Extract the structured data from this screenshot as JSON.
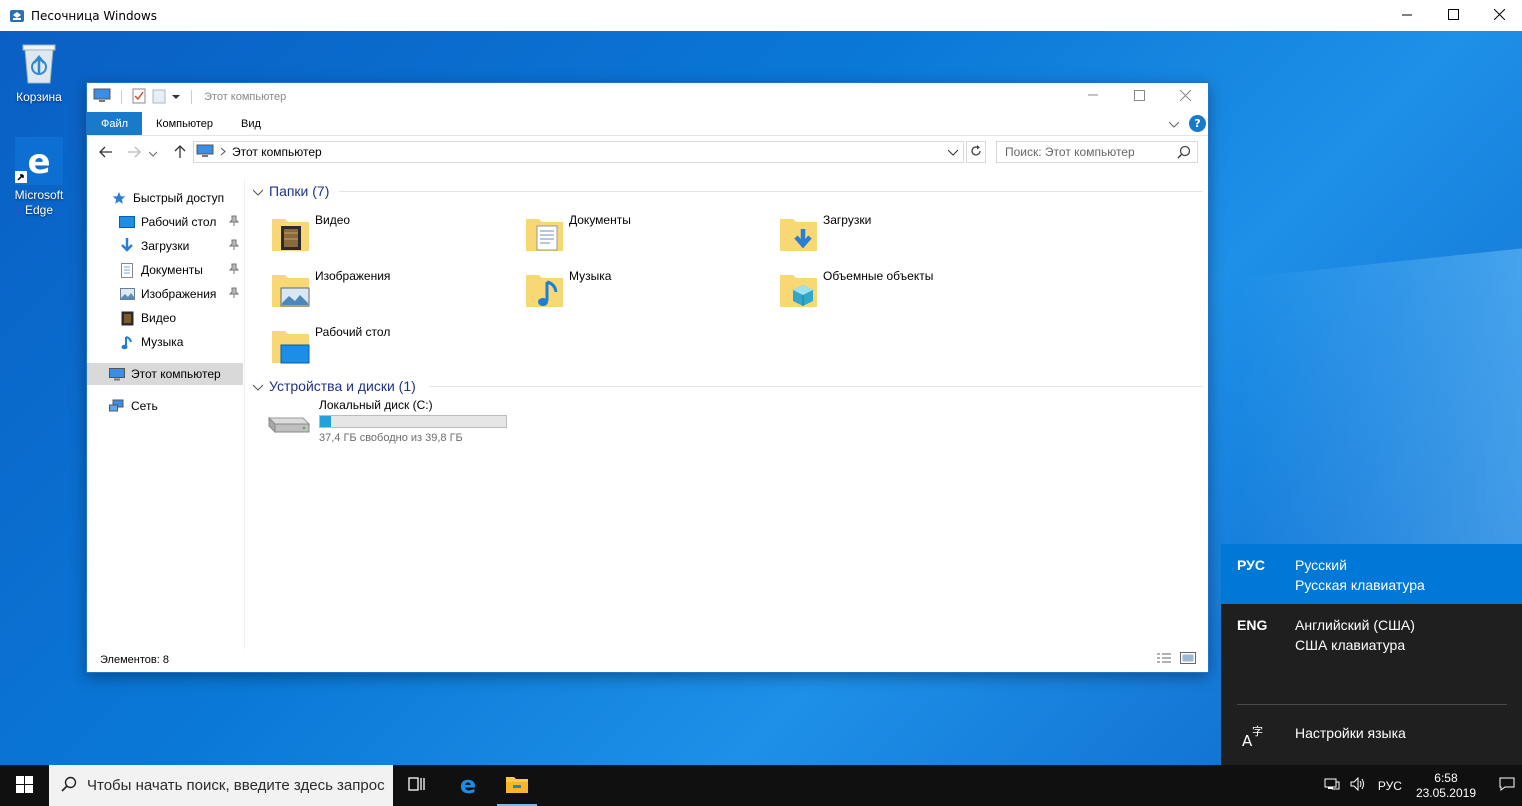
{
  "host_window": {
    "title": "Песочница Windows",
    "icon": "sandbox-icon",
    "controls": [
      "minimize-icon",
      "maximize-icon",
      "close-icon"
    ]
  },
  "desktop": {
    "icons": [
      {
        "label": "Корзина",
        "icon": "recycle-bin-icon"
      },
      {
        "label": "Microsoft Edge",
        "icon": "edge-icon"
      }
    ]
  },
  "explorer": {
    "title": "Этот компьютер",
    "ribbon_tabs": [
      "Файл",
      "Компьютер",
      "Вид"
    ],
    "address_crumb": "Этот компьютер",
    "search_placeholder": "Поиск: Этот компьютер",
    "nav_items": [
      {
        "label": "Быстрый доступ",
        "icon": "star-icon"
      },
      {
        "label": "Рабочий стол",
        "icon": "desktop-icon",
        "pinned": true
      },
      {
        "label": "Загрузки",
        "icon": "download-icon",
        "pinned": true
      },
      {
        "label": "Документы",
        "icon": "document-icon",
        "pinned": true
      },
      {
        "label": "Изображения",
        "icon": "image-icon",
        "pinned": true
      },
      {
        "label": "Видео",
        "icon": "video-icon"
      },
      {
        "label": "Музыка",
        "icon": "music-icon"
      },
      {
        "label": "Этот компьютер",
        "icon": "computer-icon",
        "selected": true
      },
      {
        "label": "Сеть",
        "icon": "network-icon"
      }
    ],
    "folders_header": "Папки (7)",
    "folders": [
      {
        "label": "Видео",
        "icon": "video-folder-icon"
      },
      {
        "label": "Документы",
        "icon": "documents-folder-icon"
      },
      {
        "label": "Загрузки",
        "icon": "downloads-folder-icon"
      },
      {
        "label": "Изображения",
        "icon": "pictures-folder-icon"
      },
      {
        "label": "Музыка",
        "icon": "music-folder-icon"
      },
      {
        "label": "Объемные объекты",
        "icon": "3d-objects-folder-icon"
      },
      {
        "label": "Рабочий стол",
        "icon": "desktop-folder-icon"
      }
    ],
    "devices_header": "Устройства и диски (1)",
    "drive": {
      "label": "Локальный диск (C:)",
      "free_text": "37,4 ГБ свободно из 39,8 ГБ",
      "used_fraction": 0.06
    },
    "status": "Элементов: 8"
  },
  "language_popup": {
    "items": [
      {
        "code": "РУС",
        "line1": "Русский",
        "line2": "Русская клавиатура",
        "active": true
      },
      {
        "code": "ENG",
        "line1": "Английский (США)",
        "line2": "США клавиатура",
        "active": false
      }
    ],
    "settings_label": "Настройки языка"
  },
  "taskbar": {
    "search_placeholder": "Чтобы начать поиск, введите здесь запрос",
    "lang": "РУС",
    "time": "6:58",
    "date": "23.05.2019"
  },
  "colors": {
    "accent": "#0078d7",
    "ribbon_active": "#1979ca",
    "taskbar": "#101010",
    "group_header": "#1e3287"
  }
}
